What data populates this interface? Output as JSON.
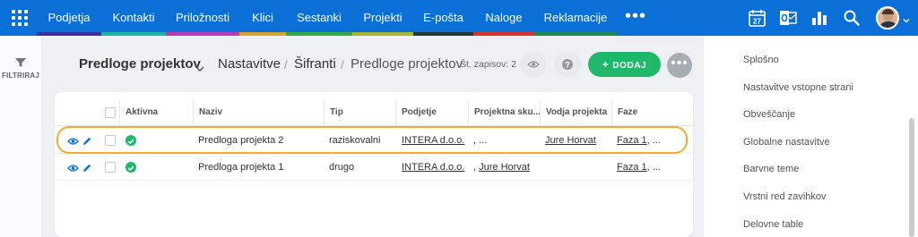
{
  "topnav": {
    "tabs": [
      {
        "label": "Podjetja",
        "stripe": "#3d2f9e"
      },
      {
        "label": "Kontakti",
        "stripe": "#18b4a8"
      },
      {
        "label": "Priložnosti",
        "stripe": "#b73bb5"
      },
      {
        "label": "Klici",
        "stripe": "#d4a62a"
      },
      {
        "label": "Sestanki",
        "stripe": "#2fa84f"
      },
      {
        "label": "Projekti",
        "stripe": "#a9b82b"
      },
      {
        "label": "E-pošta",
        "stripe": "#1c3b3a"
      },
      {
        "label": "Naloge",
        "stripe": "#d9302c"
      },
      {
        "label": "Reklamacije",
        "stripe": "#1f8a4c"
      }
    ],
    "more_label": "•••",
    "calendar_day": "27",
    "icons": [
      "apps-grid-icon",
      "calendar-icon",
      "outlook-icon",
      "reports-icon",
      "search-icon",
      "avatar",
      "chevron-down-icon"
    ]
  },
  "leftbar": {
    "filter_label": "FILTRIRAJ"
  },
  "header": {
    "view_title": "Predloge projektov",
    "breadcrumb": [
      {
        "label": "Nastavitve"
      },
      {
        "label": "Šifranti"
      },
      {
        "label": "Predloge projektov"
      }
    ],
    "separator": "/",
    "record_count": "Št. zapisov: 2",
    "add_label": "DODAJ",
    "add_plus": "+",
    "kebab": "•••"
  },
  "table": {
    "columns": [
      "Aktivna",
      "Naziv",
      "Tip",
      "Podjetje",
      "Projektna sku...",
      "Vodja projekta",
      "Faze"
    ],
    "rows": [
      {
        "aktivna": true,
        "naziv": "Predloga projekta 2",
        "tip": "raziskovalni",
        "podjetje": "INTERA d.o.o.",
        "projektna_skupina": ", ...",
        "vodja": "Jure Horvat",
        "faze": "Faza 1",
        "faze_more": ", ..."
      },
      {
        "aktivna": true,
        "naziv": "Predloga projekta 1",
        "tip": "drugo",
        "podjetje": "INTERA d.o.o.",
        "projektna_skupina_prefix": ", ",
        "projektna_skupina": "Jure Horvat",
        "vodja": "",
        "faze": "Faza 1",
        "faze_more": ", ..."
      }
    ],
    "highlight_color": "#f1ad2f"
  },
  "settings_menu": {
    "items": [
      "Splošno",
      "Nastavitve vstopne strani",
      "Obveščanje",
      "Globalne nastavitve",
      "Barvne teme",
      "Vrstni red zavihkov",
      "Delovne table"
    ]
  },
  "colors": {
    "topbar": "#0a6fd6",
    "add_button": "#1fb86a",
    "active_check": "#1fb86a"
  }
}
